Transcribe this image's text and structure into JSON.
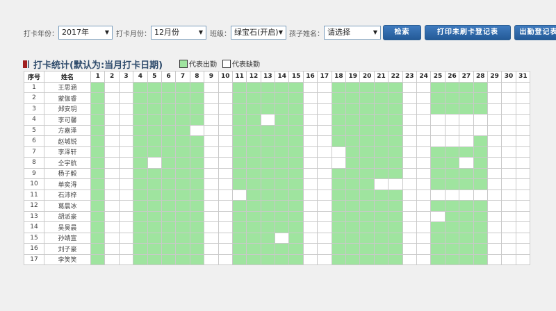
{
  "filters": {
    "year_label": "打卡年份：",
    "year_value": "2017年",
    "month_label": "打卡月份：",
    "month_value": "12月份",
    "class_label": "班级：",
    "class_value": "绿宝石(开启)",
    "child_label": "孩子姓名：",
    "child_value": "请选择"
  },
  "buttons": {
    "search": "检索",
    "print_unswiped": "打印未刷卡登记表",
    "attendance_register": "出勤登记表"
  },
  "section": {
    "title": "打卡统计(默认为:当月打卡日期)",
    "legend_present": "代表出勤",
    "legend_absent": "代表缺勤"
  },
  "colors": {
    "present": "#9fe49f",
    "absent": "#ffffff",
    "button": "#2d67a8"
  },
  "table": {
    "col_index": "序号",
    "col_name": "姓名",
    "days": [
      "1",
      "2",
      "3",
      "4",
      "5",
      "6",
      "7",
      "8",
      "9",
      "10",
      "11",
      "12",
      "13",
      "14",
      "15",
      "16",
      "17",
      "18",
      "19",
      "20",
      "21",
      "22",
      "23",
      "24",
      "25",
      "26",
      "27",
      "28",
      "29",
      "30",
      "31"
    ],
    "rows": [
      {
        "no": "1",
        "name": "王思涵",
        "absent_extra": []
      },
      {
        "no": "2",
        "name": "蒙伽睿",
        "absent_extra": []
      },
      {
        "no": "3",
        "name": "郑安玥",
        "absent_extra": []
      },
      {
        "no": "4",
        "name": "李可馨",
        "absent_extra": [
          13,
          25,
          26,
          27,
          28
        ]
      },
      {
        "no": "5",
        "name": "方嘉泽",
        "absent_extra": [
          8,
          25,
          26,
          27,
          28
        ]
      },
      {
        "no": "6",
        "name": "赵城锐",
        "absent_extra": [
          25,
          26,
          27
        ]
      },
      {
        "no": "7",
        "name": "李泽轩",
        "absent_extra": [
          18
        ]
      },
      {
        "no": "8",
        "name": "仝宇航",
        "absent_extra": [
          5,
          18,
          27
        ]
      },
      {
        "no": "9",
        "name": "杨子毅",
        "absent_extra": []
      },
      {
        "no": "10",
        "name": "单奕淂",
        "absent_extra": [
          21,
          22
        ]
      },
      {
        "no": "11",
        "name": "石沛梓",
        "absent_extra": [
          11,
          25,
          26,
          27,
          28
        ]
      },
      {
        "no": "12",
        "name": "葛晨冰",
        "absent_extra": []
      },
      {
        "no": "13",
        "name": "胡派豪",
        "absent_extra": [
          25
        ]
      },
      {
        "no": "14",
        "name": "吴昊晨",
        "absent_extra": []
      },
      {
        "no": "15",
        "name": "孙靖宣",
        "absent_extra": [
          14
        ]
      },
      {
        "no": "16",
        "name": "刘子豪",
        "absent_extra": []
      },
      {
        "no": "17",
        "name": "李笑笑",
        "absent_extra": []
      }
    ],
    "workdays": [
      1,
      4,
      5,
      6,
      7,
      8,
      11,
      12,
      13,
      14,
      15,
      18,
      19,
      20,
      21,
      22,
      25,
      26,
      27,
      28
    ]
  }
}
